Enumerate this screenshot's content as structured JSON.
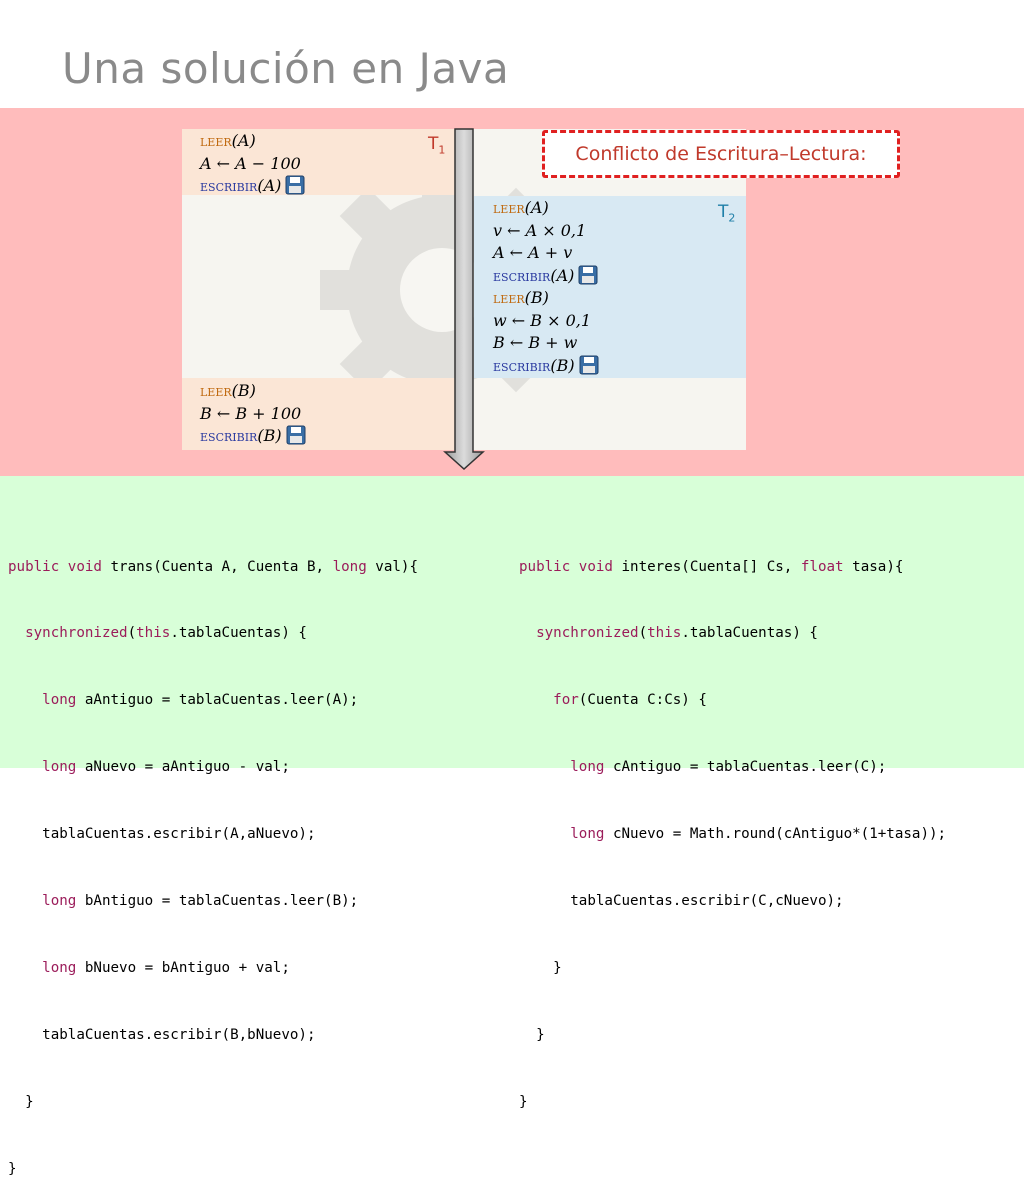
{
  "title": "Una solución en Java",
  "transactions": {
    "t1_label": "T",
    "t1_sub": "1",
    "t2_label": "T",
    "t2_sub": "2",
    "kw_leer": "leer",
    "kw_escribir": "escribir",
    "t1_part1": {
      "op1_arg": "(A)",
      "op2": "A ← A − 100",
      "op3_arg": "(A)"
    },
    "t2_ops": {
      "op1_arg": "(A)",
      "op2": "v ← A × 0,1",
      "op3": "A ← A + v",
      "op4_arg": "(A)",
      "op5_arg": "(B)",
      "op6": "w ← B × 0,1",
      "op7": "B ← B + w",
      "op8_arg": "(B)"
    },
    "t1_part2": {
      "op1_arg": "(B)",
      "op2": "B ← B + 100",
      "op3_arg": "(B)"
    }
  },
  "conflict_label": "Conflicto de Escritura–Lectura:",
  "code_left": {
    "l1a": "public void",
    "l1b": " trans(Cuenta A, Cuenta B, ",
    "l1c": "long",
    "l1d": " val){",
    "l2a": "  synchronized",
    "l2b": "(",
    "l2c": "this",
    "l2d": ".tablaCuentas) {",
    "l3a": "    long",
    "l3b": " aAntiguo = tablaCuentas.leer(A);",
    "l4a": "    long",
    "l4b": " aNuevo = aAntiguo - val;",
    "l5": "    tablaCuentas.escribir(A,aNuevo);",
    "l6a": "    long",
    "l6b": " bAntiguo = tablaCuentas.leer(B);",
    "l7a": "    long",
    "l7b": " bNuevo = bAntiguo + val;",
    "l8": "    tablaCuentas.escribir(B,bNuevo);",
    "l9": "  }",
    "l10": "}"
  },
  "code_right": {
    "l1a": "public void",
    "l1b": " interes(Cuenta[] Cs, ",
    "l1c": "float",
    "l1d": " tasa){",
    "l2a": "  synchronized",
    "l2b": "(",
    "l2c": "this",
    "l2d": ".tablaCuentas) {",
    "l3a": "    for",
    "l3b": "(Cuenta C:Cs) {",
    "l4a": "      long",
    "l4b": " cAntiguo = tablaCuentas.leer(C);",
    "l5a": "      long",
    "l5b": " cNuevo = Math.round(cAntiguo*(1+tasa));",
    "l6": "      tablaCuentas.escribir(C,cNuevo);",
    "l7": "    }",
    "l8": "  }",
    "l9": "}"
  }
}
